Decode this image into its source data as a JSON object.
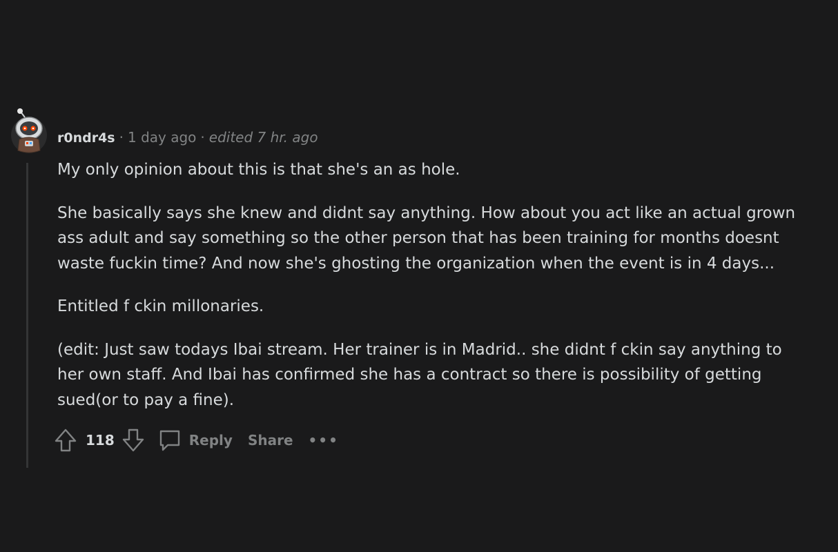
{
  "comment": {
    "author": "r0ndr4s",
    "separator": "·",
    "time": "1 day ago",
    "edited": "edited 7 hr. ago",
    "paragraphs": [
      "My only opinion about this is that she's an as  hole.",
      "She basically says she knew and didnt say anything. How about you act like an actual grown ass adult and say something so the other person that has been training for months doesnt waste fuckin time? And now she's ghosting the organization when the event is in 4 days...",
      "Entitled f  ckin millonaries.",
      "(edit: Just saw todays Ibai stream. Her trainer is in Madrid.. she didnt f  ckin say anything to her own staff. And Ibai has confirmed she has a contract so there is possibility of getting sued(or to pay a fine)."
    ]
  },
  "actions": {
    "vote_count": "118",
    "reply_label": "Reply",
    "share_label": "Share",
    "more_label": "•••"
  },
  "icons": {
    "upvote": "upvote-arrow-icon",
    "downvote": "downvote-arrow-icon",
    "reply": "speech-bubble-icon",
    "avatar": "snoo-astronaut-avatar"
  },
  "colors": {
    "background": "#1a1a1b",
    "text": "#d7dadc",
    "muted": "#818384",
    "thread_line": "#343536"
  }
}
